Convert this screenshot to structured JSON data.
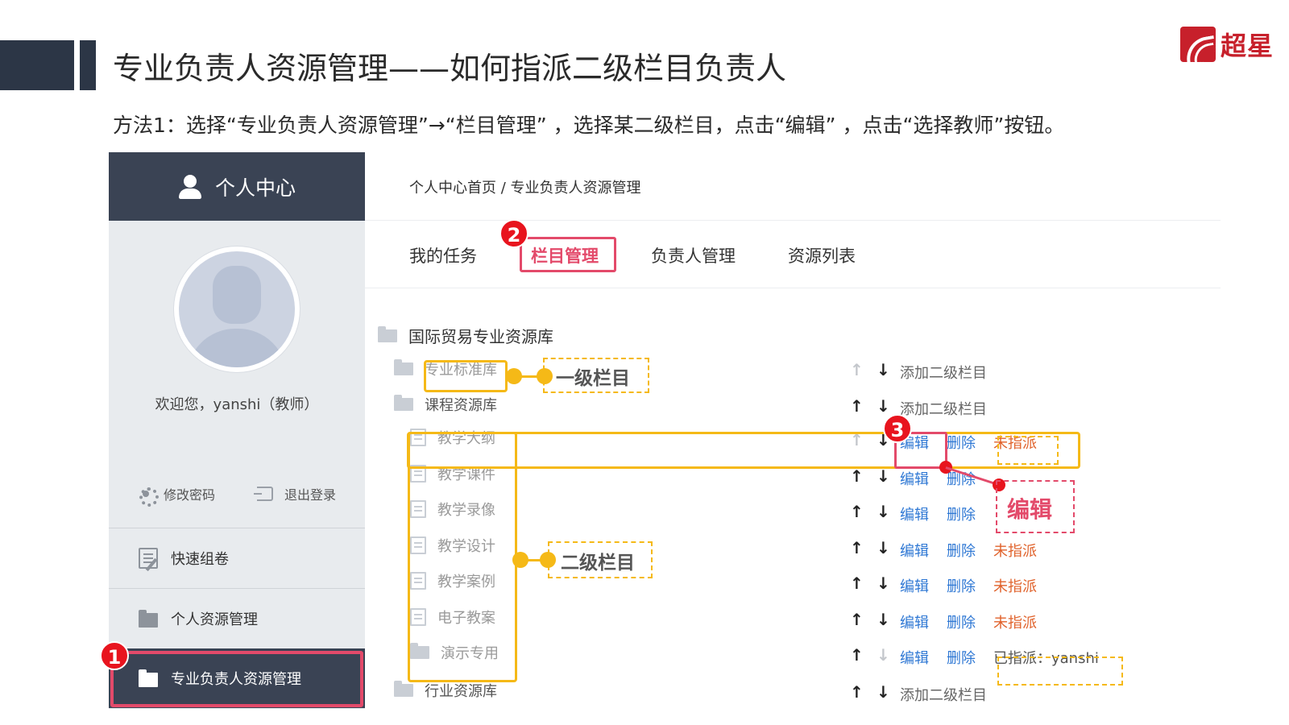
{
  "slide": {
    "title": "专业负责人资源管理——如何指派二级栏目负责人",
    "subtitle": "方法1：选择“专业负责人资源管理”→“栏目管理” ，选择某二级栏目，点击“编辑” ，点击“选择教师”按钮。",
    "logo_text": "超星"
  },
  "sidebar": {
    "header": "个人中心",
    "welcome": "欢迎您，yanshi（教师）",
    "change_password": "修改密码",
    "logout": "退出登录",
    "items": [
      {
        "label": "快速组卷"
      },
      {
        "label": "个人资源管理"
      },
      {
        "label": "专业负责人资源管理"
      }
    ]
  },
  "main": {
    "breadcrumb": "个人中心首页 / 专业负责人资源管理",
    "tabs": [
      {
        "label": "我的任务"
      },
      {
        "label": "栏目管理"
      },
      {
        "label": "负责人管理"
      },
      {
        "label": "资源列表"
      }
    ]
  },
  "tree": {
    "root": "国际贸易专业资源库",
    "level1": [
      "专业标准库",
      "课程资源库",
      "行业资源库"
    ],
    "level2": [
      "教学大纲",
      "教学课件",
      "教学录像",
      "教学设计",
      "教学案例",
      "电子教案",
      "演示专用"
    ]
  },
  "actions": {
    "up": "↑",
    "down": "↓",
    "add_sub": "添加二级栏目",
    "edit": "编辑",
    "delete": "删除",
    "unassigned": "未指派",
    "assigned": "已指派：yanshi"
  },
  "annotations": {
    "level1_label": "一级栏目",
    "level2_label": "二级栏目",
    "edit_label": "编辑",
    "step1": "1",
    "step2": "2",
    "step3": "3"
  },
  "colors": {
    "dark": "#3a4354",
    "highlight_pink": "#e34a6a",
    "highlight_yellow": "#f5b917",
    "link_blue": "#2f78d4",
    "unassigned_orange": "#e0622b"
  }
}
